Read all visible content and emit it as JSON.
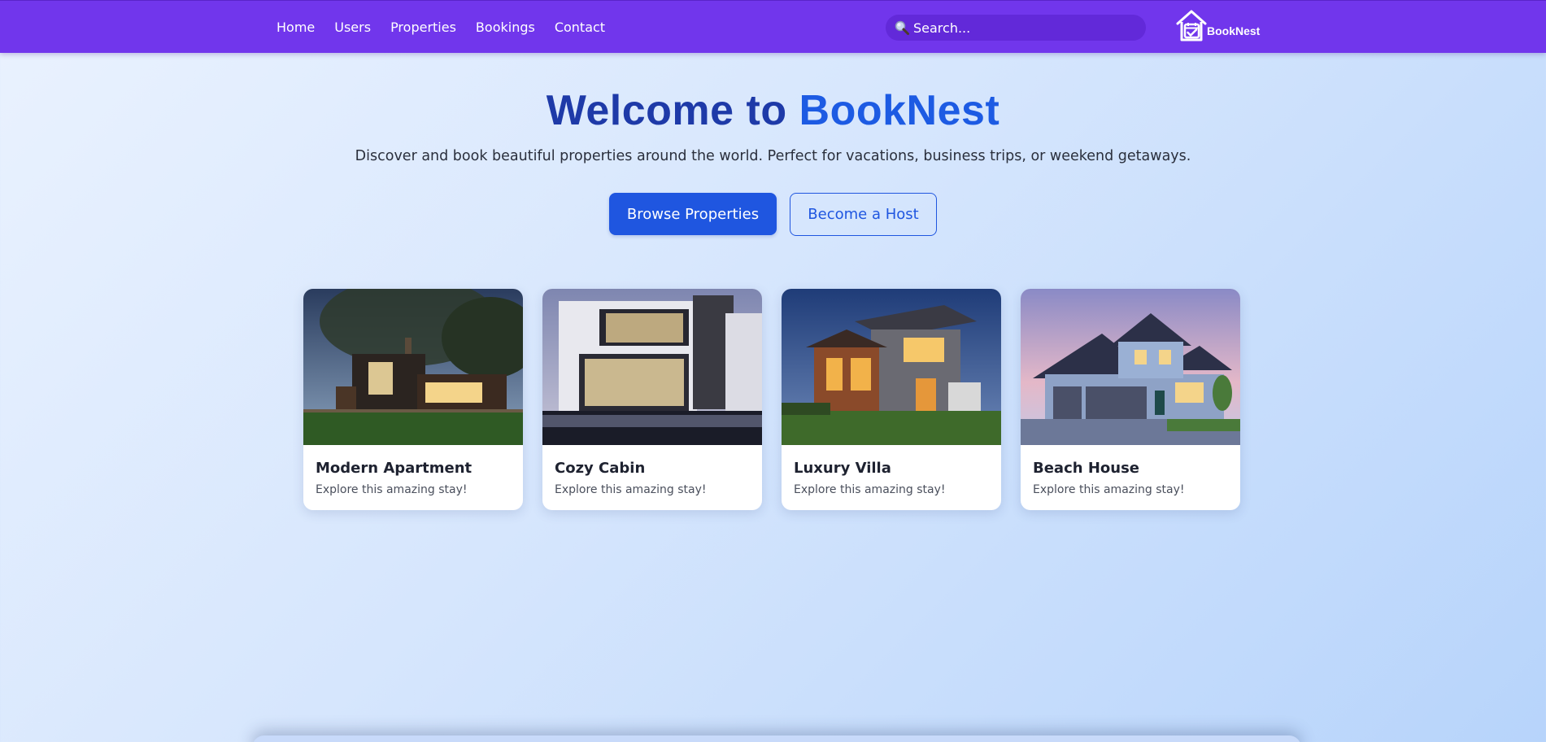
{
  "nav": {
    "links": [
      "Home",
      "Users",
      "Properties",
      "Bookings",
      "Contact"
    ],
    "search_placeholder": "Search...",
    "brand_name": "BookNest"
  },
  "hero": {
    "title_prefix": "Welcome to ",
    "title_accent": "BookNest",
    "subtitle": "Discover and book beautiful properties around the world. Perfect for vacations, business trips, or weekend getaways.",
    "primary_button": "Browse Properties",
    "secondary_button": "Become a Host"
  },
  "cards": [
    {
      "title": "Modern Apartment",
      "desc": "Explore this amazing stay!"
    },
    {
      "title": "Cozy Cabin",
      "desc": "Explore this amazing stay!"
    },
    {
      "title": "Luxury Villa",
      "desc": "Explore this amazing stay!"
    },
    {
      "title": "Beach House",
      "desc": "Explore this amazing stay!"
    }
  ],
  "colors": {
    "navbar": "#7136ec",
    "accent": "#1d5be3",
    "title": "#1e3aa8"
  }
}
